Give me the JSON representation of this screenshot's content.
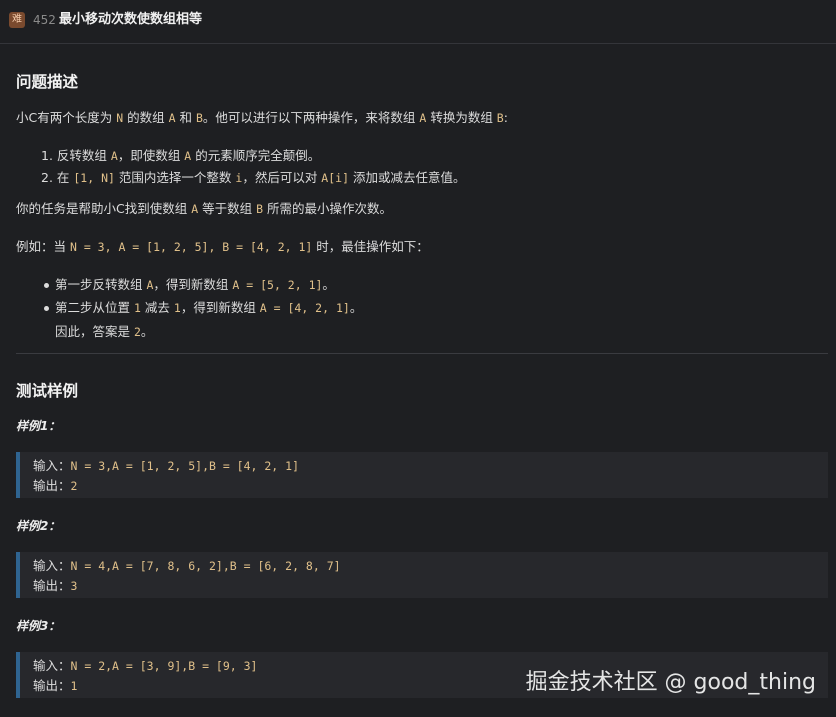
{
  "header": {
    "badge": "难",
    "number": "452",
    "title": "最小移动次数使数组相等"
  },
  "desc": {
    "heading": "问题描述",
    "intro": [
      "小C有两个长度为 ",
      "N",
      " 的数组 ",
      "A",
      " 和 ",
      "B",
      "。他可以进行以下两种操作，来将数组 ",
      "A",
      " 转换为数组 ",
      "B",
      ":"
    ],
    "op1": [
      "1. 反转数组 ",
      "A",
      "，即使数组 ",
      "A",
      " 的元素顺序完全颠倒。"
    ],
    "op2": [
      "2. 在 ",
      "[1, N]",
      " 范围内选择一个整数 ",
      "i",
      "，然后可以对 ",
      "A[i]",
      " 添加或减去任意值。"
    ],
    "task": [
      "你的任务是帮助小C找到使数组 ",
      "A",
      " 等于数组 ",
      "B",
      " 所需的最小操作次数。"
    ],
    "example": [
      "例如：当 ",
      "N = 3, A = [1, 2, 5], B = [4, 2, 1]",
      " 时，最佳操作如下："
    ],
    "step1": [
      "第一步反转数组 ",
      "A",
      "，得到新数组 ",
      "A = [5, 2, 1]",
      "。"
    ],
    "step2": [
      "第二步从位置 ",
      "1",
      " 减去 ",
      "1",
      "，得到新数组 ",
      "A = [4, 2, 1]",
      "。"
    ],
    "conclusion": [
      "因此，答案是 ",
      "2",
      "。"
    ]
  },
  "tests": {
    "heading": "测试样例",
    "samples": [
      {
        "label": "样例1：",
        "input_label": "输入：",
        "input": "N = 3,A = [1, 2, 5],B = [4, 2, 1]",
        "output_label": "输出：",
        "output": "2"
      },
      {
        "label": "样例2：",
        "input_label": "输入：",
        "input": "N = 4,A = [7, 8, 6, 2],B = [6, 2, 8, 7]",
        "output_label": "输出：",
        "output": "3"
      },
      {
        "label": "样例3：",
        "input_label": "输入：",
        "input": "N = 2,A = [3, 9],B = [9, 3]",
        "output_label": "输出：",
        "output": "1"
      }
    ]
  },
  "watermark": "掘金技术社区 @ good_thing"
}
